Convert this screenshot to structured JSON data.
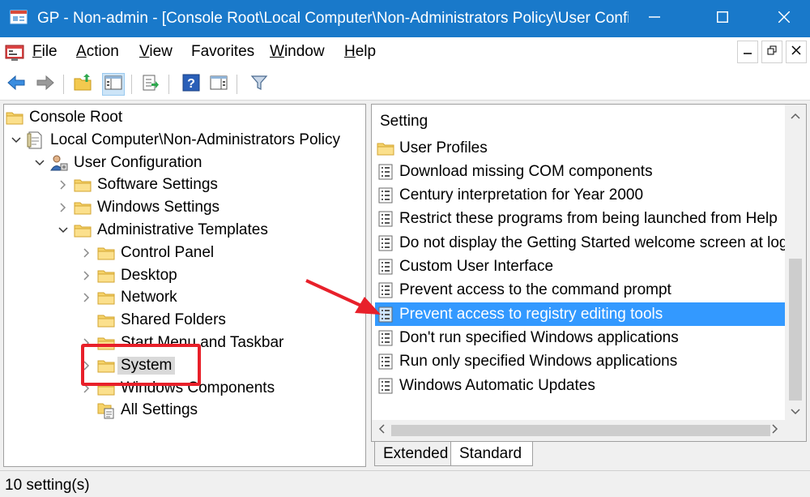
{
  "window": {
    "title": "GP - Non-admin - [Console Root\\Local Computer\\Non-Administrators Policy\\User Confi...",
    "icons": {
      "app": "gp-app-icon",
      "minimize": "minimize-icon",
      "maximize": "maximize-icon",
      "close": "close-icon"
    }
  },
  "menubar": {
    "items": [
      {
        "label": "File",
        "ul": "F",
        "rest": "ile"
      },
      {
        "label": "Action",
        "ul": "A",
        "rest": "ction"
      },
      {
        "label": "View",
        "ul": "V",
        "rest": "iew"
      },
      {
        "label": "Favorites",
        "ul": "",
        "rest": "Favorites"
      },
      {
        "label": "Window",
        "ul": "W",
        "rest": "indow"
      },
      {
        "label": "Help",
        "ul": "H",
        "rest": "elp"
      }
    ]
  },
  "tree": {
    "items": [
      {
        "label": "Console Root",
        "icon": "folder-icon",
        "expander": "none"
      },
      {
        "label": "Local Computer\\Non-Administrators Policy",
        "icon": "policy-document-icon",
        "expander": "expanded"
      },
      {
        "label": "User Configuration",
        "icon": "user-config-icon",
        "expander": "expanded"
      },
      {
        "label": "Software Settings",
        "icon": "folder-icon",
        "expander": "collapsed"
      },
      {
        "label": "Windows Settings",
        "icon": "folder-icon",
        "expander": "collapsed"
      },
      {
        "label": "Administrative Templates",
        "icon": "folder-icon",
        "expander": "expanded"
      },
      {
        "label": "Control Panel",
        "icon": "folder-icon",
        "expander": "collapsed"
      },
      {
        "label": "Desktop",
        "icon": "folder-icon",
        "expander": "collapsed"
      },
      {
        "label": "Network",
        "icon": "folder-icon",
        "expander": "collapsed"
      },
      {
        "label": "Shared Folders",
        "icon": "folder-icon",
        "expander": "none"
      },
      {
        "label": "Start Menu and Taskbar",
        "icon": "folder-icon",
        "expander": "collapsed"
      },
      {
        "label": "System",
        "icon": "folder-icon",
        "expander": "collapsed",
        "selected": true
      },
      {
        "label": "Windows Components",
        "icon": "folder-icon",
        "expander": "collapsed"
      },
      {
        "label": "All Settings",
        "icon": "all-settings-icon",
        "expander": "none"
      }
    ]
  },
  "list": {
    "column_header": "Setting",
    "items": [
      {
        "label": "User Profiles",
        "icon": "folder-icon"
      },
      {
        "label": "Download missing COM components",
        "icon": "setting-icon"
      },
      {
        "label": "Century interpretation for Year 2000",
        "icon": "setting-icon"
      },
      {
        "label": "Restrict these programs from being launched from Help",
        "icon": "setting-icon"
      },
      {
        "label": "Do not display the Getting Started welcome screen at logon",
        "icon": "setting-icon"
      },
      {
        "label": "Custom User Interface",
        "icon": "setting-icon"
      },
      {
        "label": "Prevent access to the command prompt",
        "icon": "setting-icon"
      },
      {
        "label": "Prevent access to registry editing tools",
        "icon": "setting-icon",
        "selected": true
      },
      {
        "label": "Don't run specified Windows applications",
        "icon": "setting-icon"
      },
      {
        "label": "Run only specified Windows applications",
        "icon": "setting-icon"
      },
      {
        "label": "Windows Automatic Updates",
        "icon": "setting-icon"
      }
    ]
  },
  "tabs": [
    {
      "label": "Extended"
    },
    {
      "label": "Standard",
      "active": true
    }
  ],
  "status": {
    "text": "10 setting(s)"
  },
  "colors": {
    "titlebar": "#1979ca",
    "selection": "#3399ff",
    "annotation": "#e8202a"
  }
}
